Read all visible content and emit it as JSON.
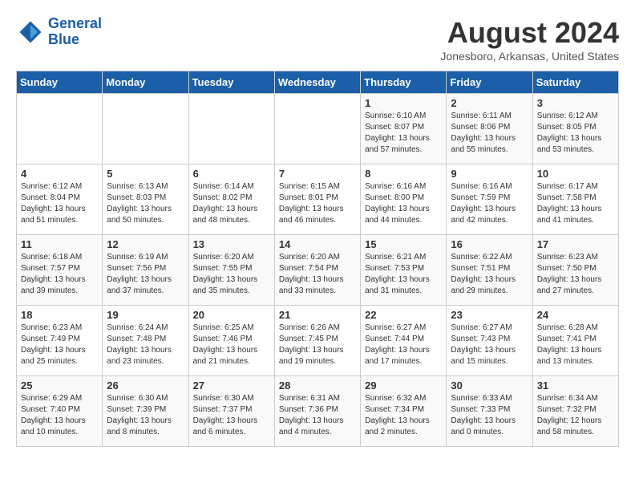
{
  "header": {
    "logo_line1": "General",
    "logo_line2": "Blue",
    "month_year": "August 2024",
    "location": "Jonesboro, Arkansas, United States"
  },
  "weekdays": [
    "Sunday",
    "Monday",
    "Tuesday",
    "Wednesday",
    "Thursday",
    "Friday",
    "Saturday"
  ],
  "weeks": [
    [
      {
        "day": "",
        "sunrise": "",
        "sunset": "",
        "daylight": ""
      },
      {
        "day": "",
        "sunrise": "",
        "sunset": "",
        "daylight": ""
      },
      {
        "day": "",
        "sunrise": "",
        "sunset": "",
        "daylight": ""
      },
      {
        "day": "",
        "sunrise": "",
        "sunset": "",
        "daylight": ""
      },
      {
        "day": "1",
        "sunrise": "6:10 AM",
        "sunset": "8:07 PM",
        "daylight": "13 hours and 57 minutes."
      },
      {
        "day": "2",
        "sunrise": "6:11 AM",
        "sunset": "8:06 PM",
        "daylight": "13 hours and 55 minutes."
      },
      {
        "day": "3",
        "sunrise": "6:12 AM",
        "sunset": "8:05 PM",
        "daylight": "13 hours and 53 minutes."
      }
    ],
    [
      {
        "day": "4",
        "sunrise": "6:12 AM",
        "sunset": "8:04 PM",
        "daylight": "13 hours and 51 minutes."
      },
      {
        "day": "5",
        "sunrise": "6:13 AM",
        "sunset": "8:03 PM",
        "daylight": "13 hours and 50 minutes."
      },
      {
        "day": "6",
        "sunrise": "6:14 AM",
        "sunset": "8:02 PM",
        "daylight": "13 hours and 48 minutes."
      },
      {
        "day": "7",
        "sunrise": "6:15 AM",
        "sunset": "8:01 PM",
        "daylight": "13 hours and 46 minutes."
      },
      {
        "day": "8",
        "sunrise": "6:16 AM",
        "sunset": "8:00 PM",
        "daylight": "13 hours and 44 minutes."
      },
      {
        "day": "9",
        "sunrise": "6:16 AM",
        "sunset": "7:59 PM",
        "daylight": "13 hours and 42 minutes."
      },
      {
        "day": "10",
        "sunrise": "6:17 AM",
        "sunset": "7:58 PM",
        "daylight": "13 hours and 41 minutes."
      }
    ],
    [
      {
        "day": "11",
        "sunrise": "6:18 AM",
        "sunset": "7:57 PM",
        "daylight": "13 hours and 39 minutes."
      },
      {
        "day": "12",
        "sunrise": "6:19 AM",
        "sunset": "7:56 PM",
        "daylight": "13 hours and 37 minutes."
      },
      {
        "day": "13",
        "sunrise": "6:20 AM",
        "sunset": "7:55 PM",
        "daylight": "13 hours and 35 minutes."
      },
      {
        "day": "14",
        "sunrise": "6:20 AM",
        "sunset": "7:54 PM",
        "daylight": "13 hours and 33 minutes."
      },
      {
        "day": "15",
        "sunrise": "6:21 AM",
        "sunset": "7:53 PM",
        "daylight": "13 hours and 31 minutes."
      },
      {
        "day": "16",
        "sunrise": "6:22 AM",
        "sunset": "7:51 PM",
        "daylight": "13 hours and 29 minutes."
      },
      {
        "day": "17",
        "sunrise": "6:23 AM",
        "sunset": "7:50 PM",
        "daylight": "13 hours and 27 minutes."
      }
    ],
    [
      {
        "day": "18",
        "sunrise": "6:23 AM",
        "sunset": "7:49 PM",
        "daylight": "13 hours and 25 minutes."
      },
      {
        "day": "19",
        "sunrise": "6:24 AM",
        "sunset": "7:48 PM",
        "daylight": "13 hours and 23 minutes."
      },
      {
        "day": "20",
        "sunrise": "6:25 AM",
        "sunset": "7:46 PM",
        "daylight": "13 hours and 21 minutes."
      },
      {
        "day": "21",
        "sunrise": "6:26 AM",
        "sunset": "7:45 PM",
        "daylight": "13 hours and 19 minutes."
      },
      {
        "day": "22",
        "sunrise": "6:27 AM",
        "sunset": "7:44 PM",
        "daylight": "13 hours and 17 minutes."
      },
      {
        "day": "23",
        "sunrise": "6:27 AM",
        "sunset": "7:43 PM",
        "daylight": "13 hours and 15 minutes."
      },
      {
        "day": "24",
        "sunrise": "6:28 AM",
        "sunset": "7:41 PM",
        "daylight": "13 hours and 13 minutes."
      }
    ],
    [
      {
        "day": "25",
        "sunrise": "6:29 AM",
        "sunset": "7:40 PM",
        "daylight": "13 hours and 10 minutes."
      },
      {
        "day": "26",
        "sunrise": "6:30 AM",
        "sunset": "7:39 PM",
        "daylight": "13 hours and 8 minutes."
      },
      {
        "day": "27",
        "sunrise": "6:30 AM",
        "sunset": "7:37 PM",
        "daylight": "13 hours and 6 minutes."
      },
      {
        "day": "28",
        "sunrise": "6:31 AM",
        "sunset": "7:36 PM",
        "daylight": "13 hours and 4 minutes."
      },
      {
        "day": "29",
        "sunrise": "6:32 AM",
        "sunset": "7:34 PM",
        "daylight": "13 hours and 2 minutes."
      },
      {
        "day": "30",
        "sunrise": "6:33 AM",
        "sunset": "7:33 PM",
        "daylight": "13 hours and 0 minutes."
      },
      {
        "day": "31",
        "sunrise": "6:34 AM",
        "sunset": "7:32 PM",
        "daylight": "12 hours and 58 minutes."
      }
    ]
  ]
}
